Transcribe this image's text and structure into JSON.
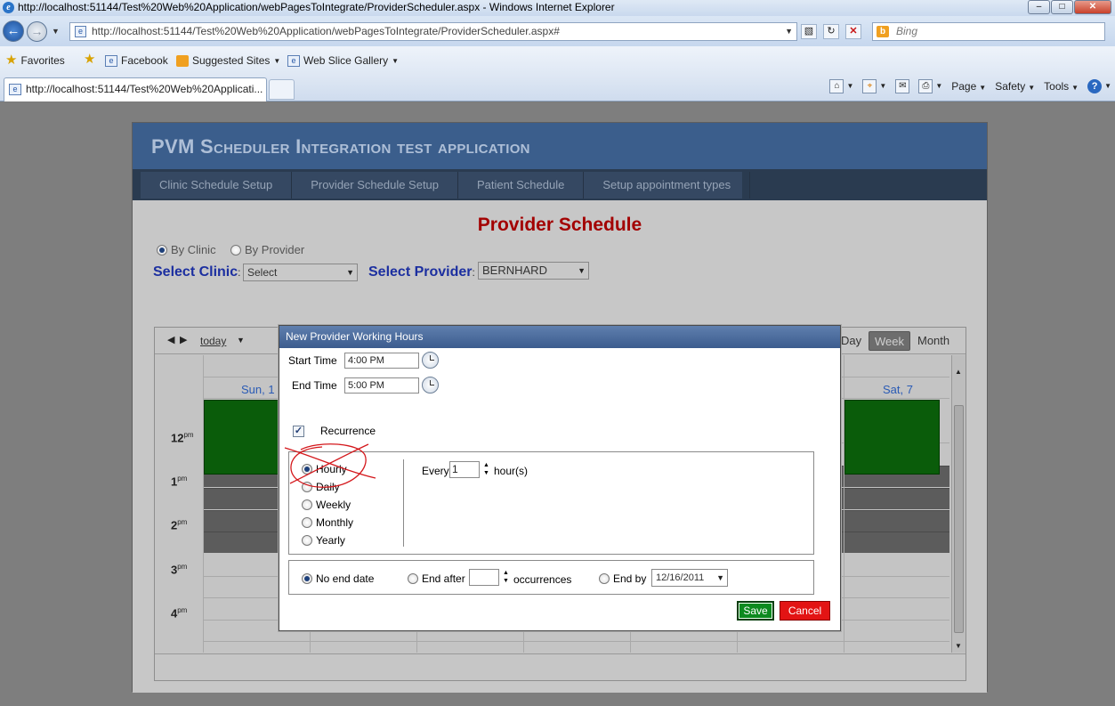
{
  "browser": {
    "window_title": "http://localhost:51144/Test%20Web%20Application/webPagesToIntegrate/ProviderScheduler.aspx - Windows Internet Explorer",
    "address": "http://localhost:51144/Test%20Web%20Application/webPagesToIntegrate/ProviderScheduler.aspx#",
    "search_placeholder": "Bing",
    "favorites": [
      "Favorites",
      "Facebook",
      "Suggested Sites",
      "Web Slice Gallery"
    ],
    "tab_title": "http://localhost:51144/Test%20Web%20Applicati...",
    "commands": [
      "Page",
      "Safety",
      "Tools"
    ]
  },
  "app": {
    "title_pvm": "PVM",
    "title_rest": "Scheduler Integration test application",
    "nav": [
      "Clinic Schedule Setup",
      "Provider Schedule Setup",
      "Patient Schedule",
      "Setup appointment types"
    ],
    "heading": "Provider Schedule",
    "mode_by_clinic": "By Clinic",
    "mode_by_provider": "By Provider",
    "select_clinic_label": "Select Clinic",
    "select_clinic_value": "Select",
    "select_provider_label": "Select Provider",
    "select_provider_value": "BERNHARD",
    "colon": ":"
  },
  "scheduler": {
    "today": "today",
    "views": {
      "day": "Day",
      "week": "Week",
      "month": "Month"
    },
    "days": {
      "first": "Sun, 1",
      "last": "Sat, 7"
    },
    "times": [
      "12",
      "1",
      "2",
      "3",
      "4"
    ],
    "pm": "pm"
  },
  "dialog": {
    "title": "New Provider Working Hours",
    "start_label": "Start Time",
    "start_value": "4:00 PM",
    "end_label": "End Time",
    "end_value": "5:00 PM",
    "recurrence_label": "Recurrence",
    "recurrence_checked": true,
    "patterns": [
      "Hourly",
      "Daily",
      "Weekly",
      "Monthly",
      "Yearly"
    ],
    "selected_pattern": "Hourly",
    "every_label": "Every",
    "every_value": "1",
    "unit_label": "hour(s)",
    "no_end_label": "No end date",
    "end_after_label": "End after",
    "end_after_value": "",
    "occurrences_label": "occurrences",
    "end_by_label": "End by",
    "end_by_value": "12/16/2011",
    "save_label": "Save",
    "cancel_label": "Cancel"
  }
}
